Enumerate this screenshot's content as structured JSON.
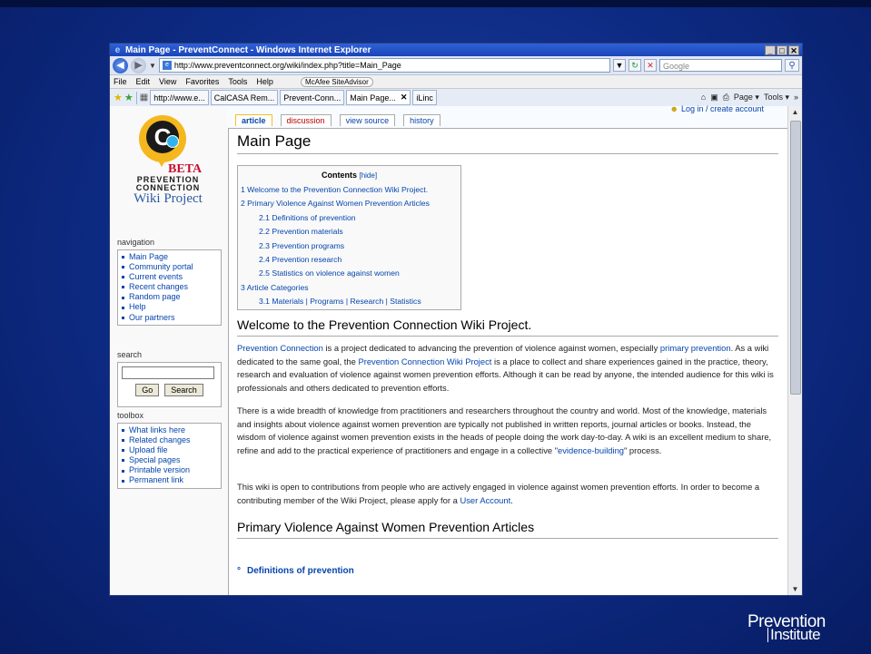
{
  "window": {
    "title": "Main Page - PreventConnect - Windows Internet Explorer",
    "controls": [
      "_",
      "□",
      "✕"
    ]
  },
  "address_bar": {
    "url": "http://www.preventconnect.org/wiki/index.php?title=Main_Page",
    "search_placeholder": "Google"
  },
  "menu": [
    "File",
    "Edit",
    "View",
    "Favorites",
    "Tools",
    "Help"
  ],
  "mcafee_label": "McAfee SiteAdvisor",
  "browser_tabs": [
    {
      "label": "http://www.e...",
      "active": false
    },
    {
      "label": "CalCASA Rem...",
      "active": false
    },
    {
      "label": "Prevent-Conn...",
      "active": false
    },
    {
      "label": "Main Page...",
      "active": true
    },
    {
      "label": "iLinc",
      "active": false
    }
  ],
  "tab_tools": {
    "page": "Page ▾",
    "tools": "Tools ▾",
    "more": "»"
  },
  "logo": {
    "beta": "BETA",
    "line1": "PREVENTION",
    "line2": "CONNECTION",
    "line3": "Wiki Project"
  },
  "sidebar": {
    "navigation_title": "navigation",
    "navigation": [
      "Main Page",
      "Community portal",
      "Current events",
      "Recent changes",
      "Random page",
      "Help",
      "Our partners"
    ],
    "search_title": "search",
    "go_label": "Go",
    "search_label": "Search",
    "toolbox_title": "toolbox",
    "toolbox": [
      "What links here",
      "Related changes",
      "Upload file",
      "Special pages",
      "Printable version",
      "Permanent link"
    ]
  },
  "login_text": "Log in / create account",
  "page_tabs": [
    {
      "label": "article"
    },
    {
      "label": "discussion"
    },
    {
      "label": "view source"
    },
    {
      "label": "history"
    }
  ],
  "page_title": "Main Page",
  "toc": {
    "title": "Contents",
    "hide": "[hide]",
    "items": [
      {
        "text": "1 Welcome to the Prevention Connection Wiki Project.",
        "sub": false
      },
      {
        "text": "2 Primary Violence Against Women Prevention Articles",
        "sub": false
      },
      {
        "text": "2.1 Definitions of prevention",
        "sub": true
      },
      {
        "text": "2.2 Prevention materials",
        "sub": true
      },
      {
        "text": "2.3 Prevention programs",
        "sub": true
      },
      {
        "text": "2.4 Prevention research",
        "sub": true
      },
      {
        "text": "2.5 Statistics on violence against women",
        "sub": true
      },
      {
        "text": "3 Article Categories",
        "sub": false
      },
      {
        "text": "3.1 Materials | Programs | Research | Statistics",
        "sub": true
      }
    ]
  },
  "section1": {
    "heading": "Welcome to the Prevention Connection Wiki Project.",
    "p1": {
      "l1": "Prevention Connection",
      "t1": " is a project dedicated to advancing the prevention of violence against women, especially ",
      "l2": "primary prevention",
      "t2": ". As a wiki dedicated to the same goal, the ",
      "l3": "Prevention Connection Wiki Project",
      "t3": " is a place to collect and share experiences gained in the practice, theory, research and evaluation of violence against women prevention efforts. Although it can be read by anyone, the intended audience for this wiki is professionals and others dedicated to prevention efforts."
    },
    "p2": {
      "t1": "There is a wide breadth of knowledge from practitioners and researchers throughout the country and world. Most of the knowledge, materials and insights about violence against women prevention are typically not published in written reports, journal articles or books. Instead, the wisdom of violence against women prevention exists in the heads of people doing the work day-to-day. A wiki is an excellent medium to share, refine and add to the practical experience of practitioners and engage in a collective \"",
      "l1": "evidence-building",
      "t2": "\" process."
    },
    "p3": {
      "t1": "This wiki is open to contributions from people who are actively engaged in violence against women prevention efforts. In order to become a contributing member of the Wiki Project, please apply for a ",
      "l1": "User Account",
      "t2": "."
    }
  },
  "section2": {
    "heading": "Primary Violence Against Women Prevention Articles",
    "first_item": "Definitions of prevention"
  },
  "brand": {
    "line1": "Prevention",
    "line2": "Institute"
  }
}
